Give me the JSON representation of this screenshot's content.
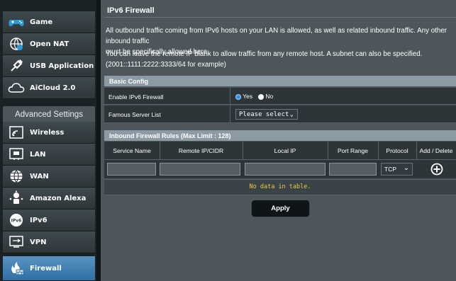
{
  "sidebar": {
    "top_items": [
      {
        "label": "Game",
        "icon": "gamepad-icon"
      },
      {
        "label": "Open NAT",
        "icon": "open-nat-icon"
      },
      {
        "label": "USB Application",
        "icon": "usb-icon"
      },
      {
        "label": "AiCloud 2.0",
        "icon": "cloud-icon"
      }
    ],
    "advanced_header": "Advanced Settings",
    "advanced_items": [
      {
        "label": "Wireless",
        "icon": "wireless-icon"
      },
      {
        "label": "LAN",
        "icon": "lan-icon"
      },
      {
        "label": "WAN",
        "icon": "globe-icon"
      },
      {
        "label": "Amazon Alexa",
        "icon": "alexa-icon"
      },
      {
        "label": "IPv6",
        "icon": "ipv6-icon"
      },
      {
        "label": "VPN",
        "icon": "vpn-icon"
      },
      {
        "label": "Firewall",
        "icon": "firewall-icon"
      }
    ],
    "active_item": "Firewall"
  },
  "main": {
    "title": "IPv6 Firewall",
    "desc1_line1": "All outbound traffic coming from IPv6 hosts on your LAN is allowed, as well as related inbound traffic. Any other inbound traffic",
    "desc1_line2": "must be specifically allowed here.",
    "desc2_line1": "You can leave the remote IP blank to allow traffic from any remote host. A subnet can also be specified.",
    "desc2_line2": "(2001::1111:2222:3333/64 for example)"
  },
  "basic_config": {
    "header": "Basic Config",
    "enable_label": "Enable IPv6 Firewall",
    "yes_label": "Yes",
    "no_label": "No",
    "selected": "Yes",
    "famous_label": "Famous Server List",
    "famous_value": "Please select"
  },
  "rules": {
    "header": "Inbound Firewall Rules (Max Limit : 128)",
    "columns": [
      "Service Name",
      "Remote IP/CIDR",
      "Local IP",
      "Port Range",
      "Protocol",
      "Add / Delete"
    ],
    "protocol_value": "TCP",
    "no_data": "No data in table."
  },
  "apply_label": "Apply",
  "colors": {
    "accent_blue": "#2f6fa3",
    "radio_selected": "#3b8fe0",
    "no_data_yellow": "#f2c63f"
  }
}
